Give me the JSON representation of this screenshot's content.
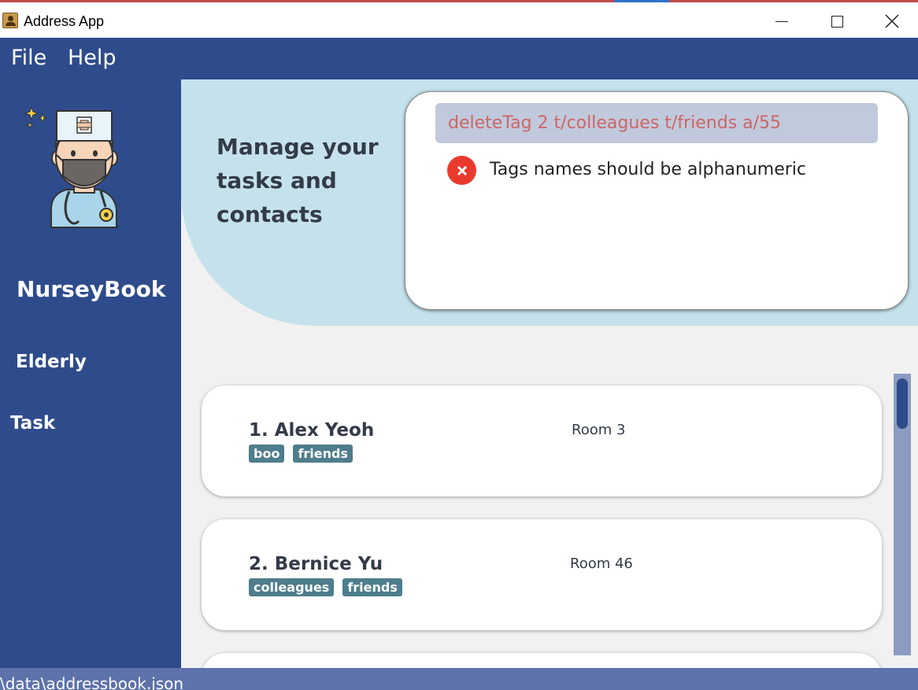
{
  "window": {
    "title": "Address App"
  },
  "menu": {
    "file": "File",
    "help": "Help"
  },
  "sidebar": {
    "brand": "NurseyBook",
    "items": [
      {
        "label": "Elderly"
      },
      {
        "label": "Task"
      }
    ]
  },
  "header": {
    "tagline": "Manage your tasks and contacts"
  },
  "command": {
    "input_value": "deleteTag 2 t/colleagues t/friends a/55",
    "result": "Tags names should be alphanumeric"
  },
  "persons": [
    {
      "name": "1. Alex Yeoh",
      "room": "Room 3",
      "tags": [
        "boo",
        "friends"
      ]
    },
    {
      "name": "2. Bernice Yu",
      "room": "Room 46",
      "tags": [
        "colleagues",
        "friends"
      ]
    }
  ],
  "status": {
    "path": "\\data\\addressbook.json"
  },
  "colors": {
    "primary": "#2e4b8b",
    "hero": "#c5e2ec",
    "error": "#ea3a2e",
    "tag": "#4e7d8c"
  },
  "icons": {
    "app": "address-book-icon",
    "error": "error-circle-icon",
    "avatar": "nurse-avatar-icon"
  }
}
